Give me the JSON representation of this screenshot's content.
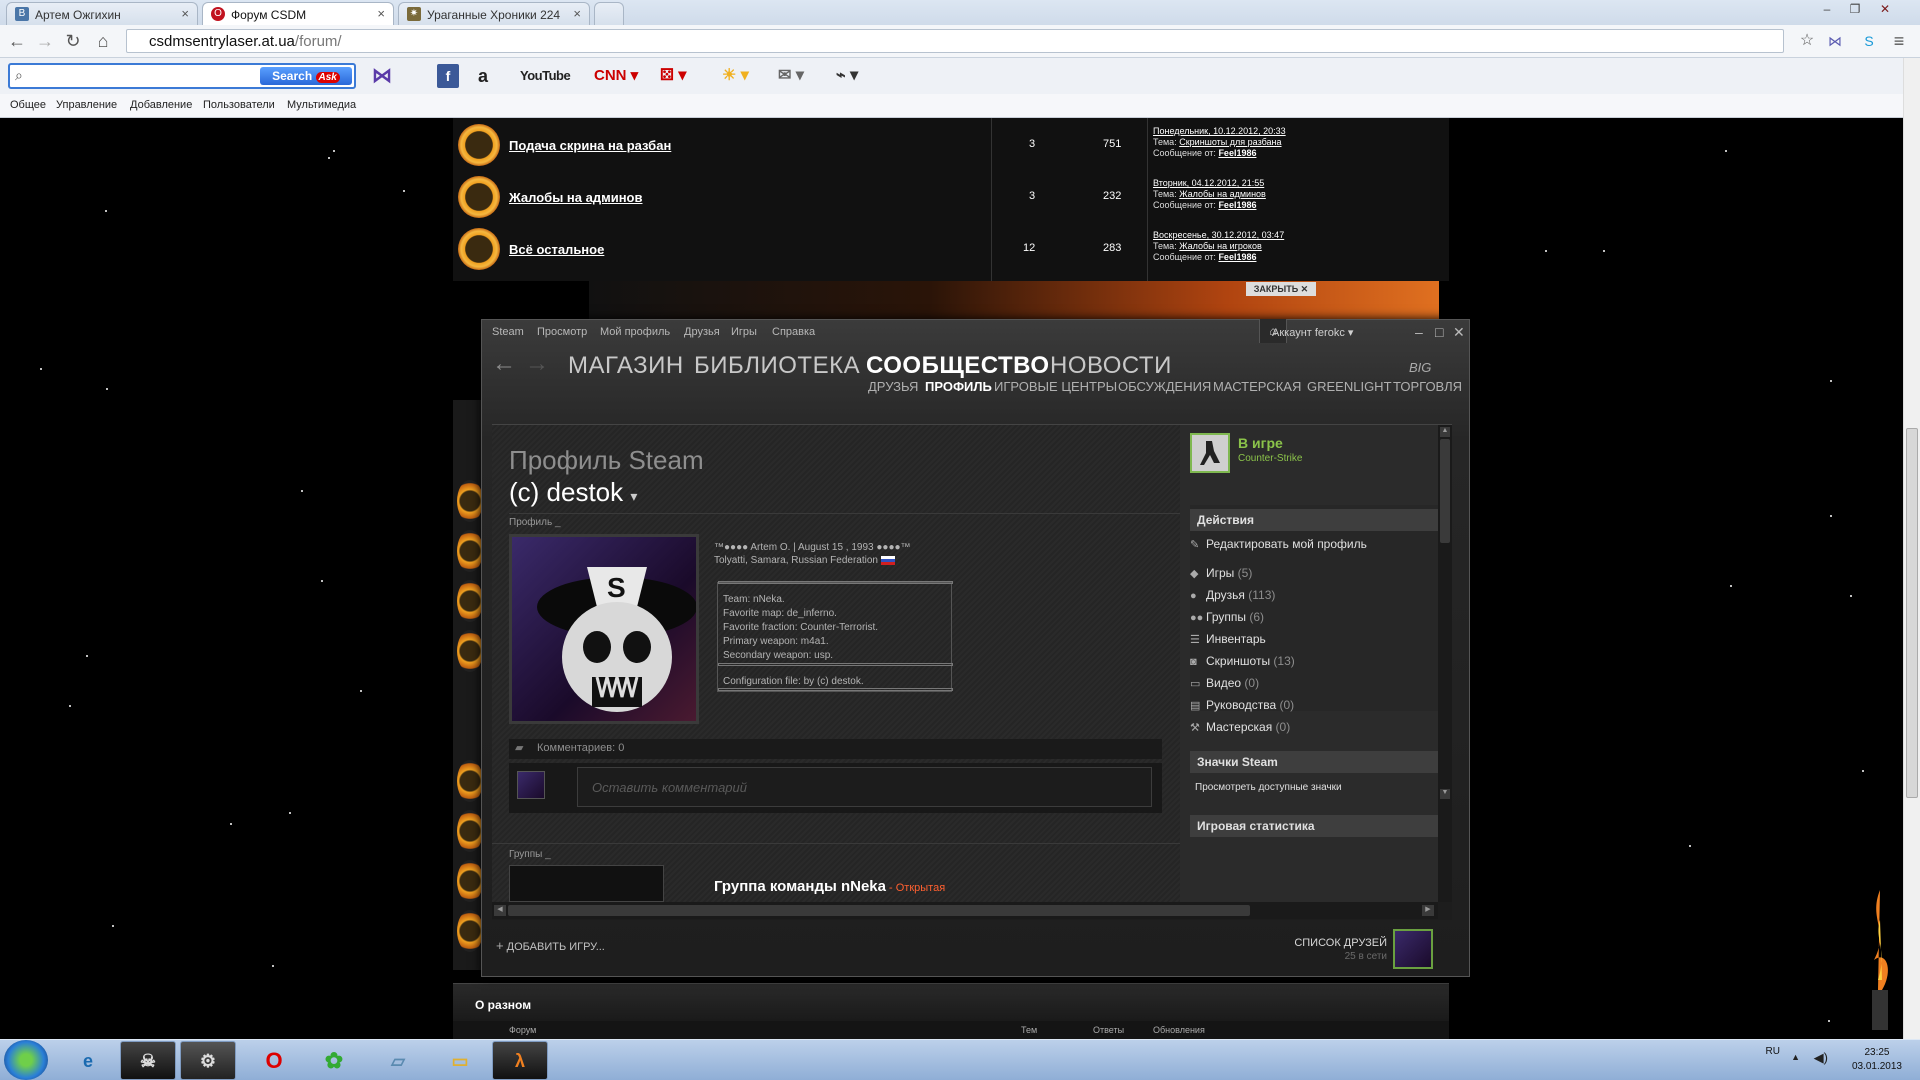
{
  "browser": {
    "tabs": [
      {
        "title": "Артем Ожгихин",
        "icon": "vk-icon"
      },
      {
        "title": "Форум CSDM",
        "icon": "opera-icon"
      },
      {
        "title": "Ураганные Хроники 224",
        "icon": "ufo-icon"
      }
    ],
    "url_host": "csdmsentrylaser.at.ua",
    "url_path": "/forum/",
    "search_button": "Search",
    "search_brand": "Ask",
    "toolbar_sites": [
      "YouTube",
      "CNN"
    ],
    "bookmarks": [
      "Общее",
      "Управление",
      "Добавление",
      "Пользователи",
      "Мультимедиа"
    ]
  },
  "forum": {
    "rows": [
      {
        "title": "Подача скрина на разбан",
        "topics": "3",
        "posts": "751",
        "last_date": "Понедельник, 10.12.2012, 20:33",
        "topic_label": "Тема:",
        "last_topic": "Скриншоты для разбана",
        "from_label": "Сообщение от:",
        "last_user": "Feel1986"
      },
      {
        "title": "Жалобы на админов",
        "topics": "3",
        "posts": "232",
        "last_date": "Вторник, 04.12.2012, 21:55",
        "topic_label": "Тема:",
        "last_topic": "Жалобы на админов",
        "from_label": "Сообщение от:",
        "last_user": "Feel1986"
      },
      {
        "title": "Всё остальное",
        "topics": "12",
        "posts": "283",
        "last_date": "Воскресенье, 30.12.2012, 03:47",
        "topic_label": "Тема:",
        "last_topic": "Жалобы на игроков",
        "from_label": "Сообщение от:",
        "last_user": "Feel1986"
      }
    ],
    "close_ad": "ЗАКРЫТЬ ✕",
    "section_title": "О разном",
    "section_headers": [
      "Форум",
      "Тем",
      "Ответы",
      "Обновления"
    ]
  },
  "steam": {
    "menu": [
      "Steam",
      "Просмотр",
      "Мой профиль",
      "Друзья",
      "Игры",
      "Справка"
    ],
    "account": "Аккаунт ferokc",
    "big_tabs": [
      "МАГАЗИН",
      "БИБЛИОТЕКА",
      "СООБЩЕСТВО",
      "НОВОСТИ"
    ],
    "sub_tabs": [
      "ДРУЗЬЯ",
      "ПРОФИЛЬ",
      "ИГРОВЫЕ ЦЕНТРЫ",
      "ОБСУЖДЕНИЯ",
      "МАСТЕРСКАЯ",
      "GREENLIGHT",
      "ТОРГОВЛЯ"
    ],
    "big_picture": "BIG",
    "profile": {
      "heading": "Профиль Steam",
      "name": "(c) destok",
      "section_label": "Профиль _",
      "line1": "™●●●● Artem O. | August 15 , 1993 ●●●●™",
      "line2": "Tolyatti, Samara, Russian Federation",
      "custom": [
        "Team: nNeka.",
        "Favorite map: de_inferno.",
        "Favorite fraction: Counter-Terrorist.",
        "Primary weapon: m4a1.",
        "Secondary weapon: usp."
      ],
      "config": "Configuration file: by (c) destok.",
      "comments": "Комментариев: 0",
      "comment_placeholder": "Оставить комментарий",
      "groups_label": "Группы _",
      "group_name": "Группа команды nNeka",
      "group_status": " - Открытая"
    },
    "sidebar": {
      "status": "В игре",
      "game": "Counter-Strike",
      "actions_title": "Действия",
      "edit_profile": "Редактировать мой профиль",
      "links": [
        {
          "label": "Игры",
          "count": "(5)",
          "icon": "gamepad-icon"
        },
        {
          "label": "Друзья",
          "count": "(113)",
          "icon": "friend-icon"
        },
        {
          "label": "Группы",
          "count": "(6)",
          "icon": "group-icon"
        },
        {
          "label": "Инвентарь",
          "count": "",
          "icon": "inventory-icon"
        },
        {
          "label": "Скриншоты",
          "count": "(13)",
          "icon": "camera-icon"
        },
        {
          "label": "Видео",
          "count": "(0)",
          "icon": "video-icon"
        },
        {
          "label": "Руководства",
          "count": "(0)",
          "icon": "guide-icon"
        },
        {
          "label": "Мастерская",
          "count": "(0)",
          "icon": "wrench-icon"
        }
      ],
      "badges_title": "Значки Steam",
      "badges_link": "Просмотреть доступные значки",
      "stats_title": "Игровая статистика"
    },
    "footer": {
      "add_game": "ДОБАВИТЬ ИГРУ...",
      "friends_list": "СПИСОК ДРУЗЕЙ",
      "friends_online": "25 в сети"
    }
  },
  "taskbar": {
    "lang": "RU",
    "time": "23:25",
    "date": "03.01.2013"
  }
}
